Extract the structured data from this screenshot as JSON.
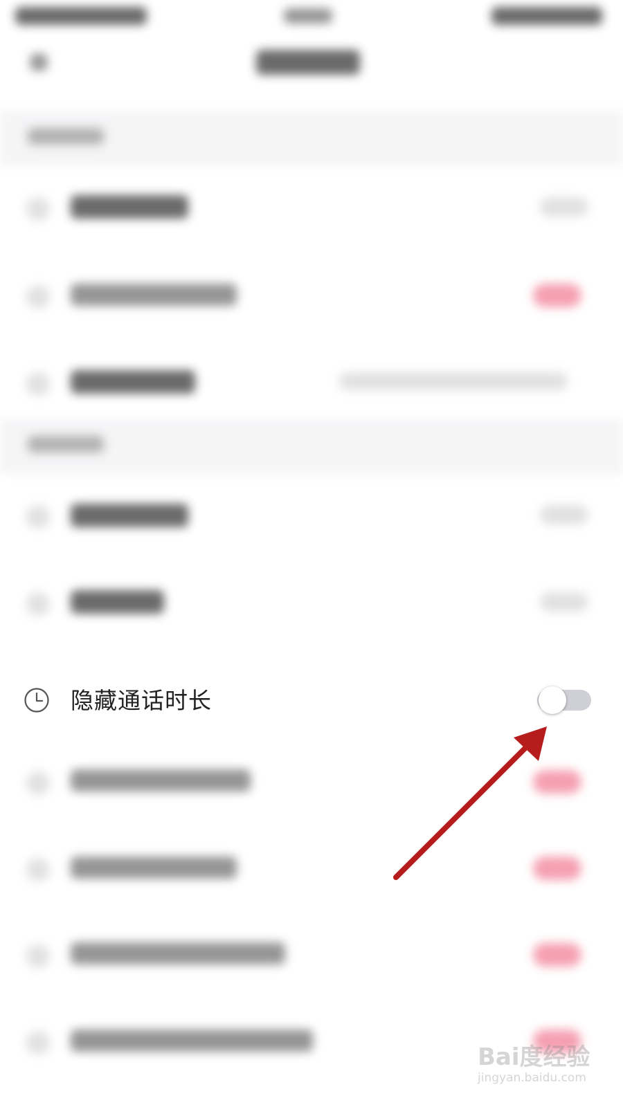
{
  "setting_row": {
    "icon": "clock-icon",
    "label": "隐藏通话时长",
    "toggle_on": false
  },
  "annotation": {
    "arrow_color": "#b71c1c"
  },
  "watermark": {
    "brand": "Bai度经验",
    "url": "jingyan.baidu.com"
  },
  "colors": {
    "toggle_off_track": "#cfcfd6",
    "accent_pink": "#f06a85"
  }
}
